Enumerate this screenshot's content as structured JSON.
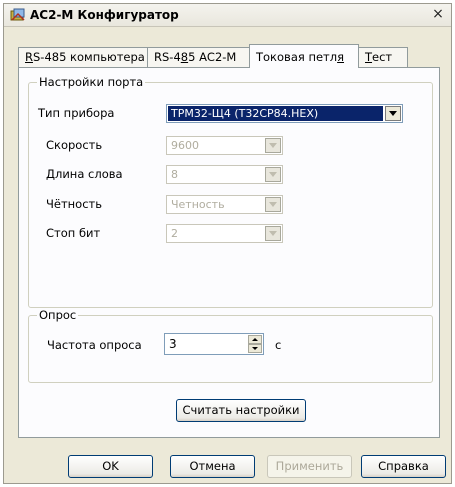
{
  "window": {
    "title": "АС2-М Конфигуратор",
    "close": "×"
  },
  "tabs": [
    {
      "pre": "",
      "u": "R",
      "post": "S-485 компьютера"
    },
    {
      "pre": "RS-4",
      "u": "8",
      "post": "5 АС2-М"
    },
    {
      "pre": "Токовая петл",
      "u": "я",
      "post": ""
    },
    {
      "pre": "",
      "u": "Т",
      "post": "ест"
    }
  ],
  "port_settings": {
    "title": "Настройки порта",
    "device_type": {
      "label": "Тип прибора",
      "value": "ТРМ32-Щ4 (T32CP84.HEX)"
    },
    "speed": {
      "label": "Скорость",
      "value": "9600"
    },
    "word_length": {
      "label": "Длина слова",
      "value": "8"
    },
    "parity": {
      "label": "Чётность",
      "value": "Четность"
    },
    "stop_bits": {
      "label": "Стоп бит",
      "value": "2"
    }
  },
  "polling": {
    "title": "Опрос",
    "frequency": {
      "label": "Частота опроса",
      "value": "3",
      "unit": "с"
    }
  },
  "read_settings_button": "Считать настройки",
  "footer": {
    "ok": "OK",
    "cancel": "Отмена",
    "apply": "Применить",
    "help": "Справка"
  }
}
